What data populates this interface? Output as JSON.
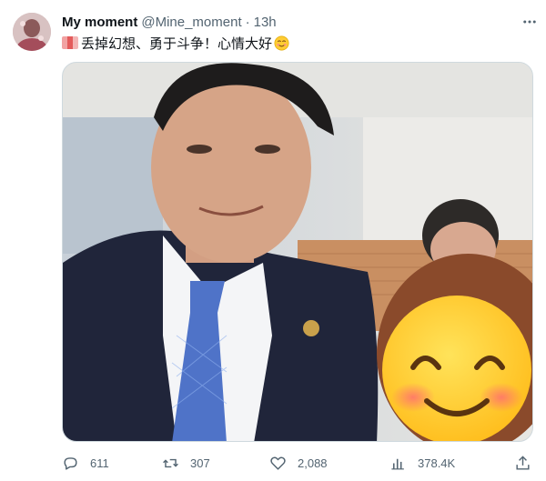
{
  "tweet": {
    "display_name": "My moment",
    "handle": "@Mine_moment",
    "separator": "·",
    "time": "13h",
    "text": "丢掉幻想、勇于斗争！心情大好",
    "avatar_icon": "avatar-image",
    "more_icon": "more-horizontal-icon",
    "media_description_icon": "photo"
  },
  "actions": {
    "replies": "611",
    "retweets": "307",
    "likes": "2,088",
    "views": "378.4K"
  },
  "colors": {
    "text_primary": "#0f1419",
    "text_secondary": "#536471",
    "border": "#cfd9de",
    "emoji_yellow": "#ffcc33"
  }
}
